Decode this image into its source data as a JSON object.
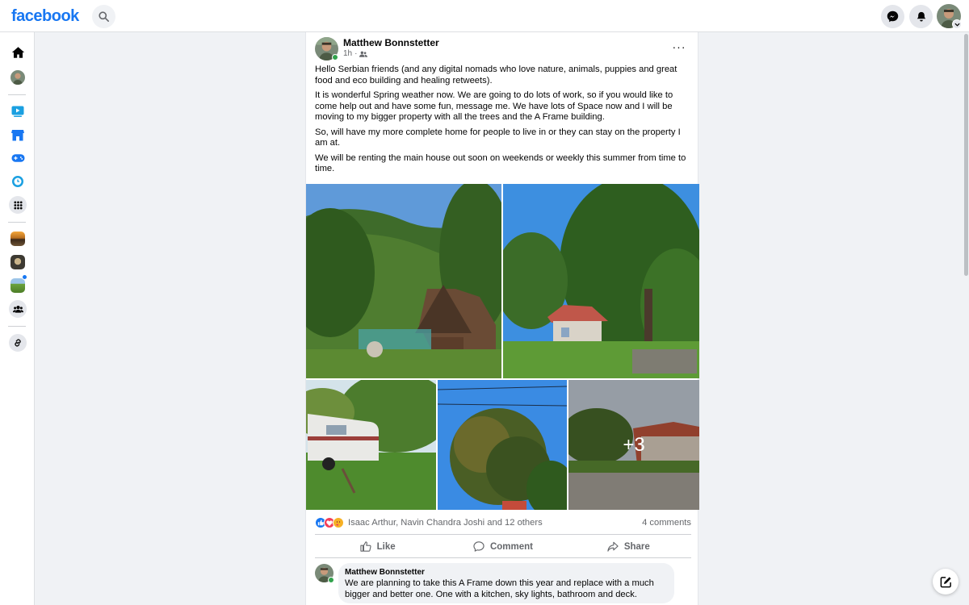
{
  "app": {
    "logo_text": "facebook",
    "brand_color": "#1877f2"
  },
  "topbar": {
    "search_icon": "search-icon",
    "messenger_icon": "messenger-icon",
    "notifications_icon": "bell-icon",
    "profile_icon": "profile-avatar"
  },
  "left_rail": {
    "items": [
      {
        "name": "home",
        "icon": "home-icon"
      },
      {
        "name": "profile",
        "icon": "avatar"
      },
      {
        "name": "watch",
        "icon": "video-icon"
      },
      {
        "name": "marketplace",
        "icon": "store-icon"
      },
      {
        "name": "gaming",
        "icon": "gamepad-icon"
      },
      {
        "name": "memories",
        "icon": "clock-icon"
      },
      {
        "name": "menu",
        "icon": "grid-icon"
      },
      {
        "name": "shortcut-1",
        "icon": "group-thumbnail"
      },
      {
        "name": "shortcut-2",
        "icon": "group-thumbnail"
      },
      {
        "name": "shortcut-3",
        "icon": "group-thumbnail"
      },
      {
        "name": "groups",
        "icon": "groups-icon"
      },
      {
        "name": "link",
        "icon": "link-icon"
      }
    ]
  },
  "post": {
    "author": "Matthew Bonnstetter",
    "time": "1h",
    "separator": "·",
    "audience_icon": "friends-icon",
    "more_label": "···",
    "paragraphs": [
      "Hello Serbian friends (and any digital nomads who love nature, animals, puppies and great food and eco building and healing retweets).",
      "It is wonderful Spring weather now.  We are going to do lots of work, so if you would like to come help out and have some fun, message me.  We have lots of Space now and I will be moving to my bigger property with all the trees and the A Frame building.",
      "So, will have my more complete home for people to live in or they can stay on the property I am at.",
      "We will be renting the main house out soon on weekends or weekly this summer from time to time."
    ],
    "photos_more_label": "+3",
    "reactions": {
      "icons": [
        "like-icon",
        "love-icon",
        "care-icon"
      ],
      "names": "Isaac Arthur, Navin Chandra Joshi and 12 others",
      "comment_count": "4 comments"
    },
    "actions": {
      "like": "Like",
      "comment": "Comment",
      "share": "Share"
    },
    "comment": {
      "author": "Matthew Bonnstetter",
      "text": "We are planning to take this A Frame down this year and replace with a much bigger and better one. One with a kitchen, sky lights, bathroom and deck."
    }
  },
  "compose_icon": "new-message-icon"
}
